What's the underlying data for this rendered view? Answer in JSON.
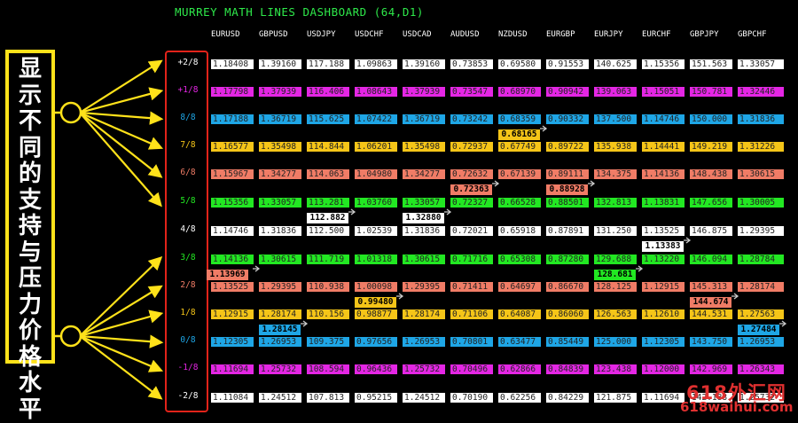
{
  "title": "MURREY MATH LINES DASHBOARD (64,D1)",
  "annotation": "显示不同的支持与压力价格水平",
  "watermark": {
    "line1": "618外汇网",
    "line2": "618waihui.com"
  },
  "colors": {
    "title": "#2ee84a",
    "annotation_box": "#ffe21a",
    "levels_box": "#e2231a"
  },
  "symbols": [
    "EURUSD",
    "GBPUSD",
    "USDJPY",
    "USDCHF",
    "USDCAD",
    "AUDUSD",
    "NZDUSD",
    "EURGBP",
    "EURJPY",
    "EURCHF",
    "GBPJPY",
    "GBPCHF"
  ],
  "levels": [
    {
      "label": "+2/8",
      "color": "#ffffff",
      "values": [
        "1.18408",
        "1.39160",
        "117.188",
        "1.09863",
        "1.39160",
        "0.73853",
        "0.69580",
        "0.91553",
        "140.625",
        "1.15356",
        "151.563",
        "1.33057"
      ]
    },
    {
      "label": "+1/8",
      "color": "#e426e4",
      "values": [
        "1.17798",
        "1.37939",
        "116.406",
        "1.08643",
        "1.37939",
        "0.73547",
        "0.68970",
        "0.90942",
        "139.063",
        "1.15051",
        "150.781",
        "1.32446"
      ]
    },
    {
      "label": "8/8",
      "color": "#1ea6e6",
      "values": [
        "1.17188",
        "1.36719",
        "115.625",
        "1.07422",
        "1.36719",
        "0.73242",
        "0.68359",
        "0.90332",
        "137.500",
        "1.14746",
        "150.000",
        "1.31836"
      ]
    },
    {
      "label": "7/8",
      "color": "#f5c518",
      "values": [
        "1.16577",
        "1.35498",
        "114.844",
        "1.06201",
        "1.35498",
        "0.72937",
        "0.67749",
        "0.89722",
        "135.938",
        "1.14441",
        "149.219",
        "1.31226"
      ]
    },
    {
      "label": "6/8",
      "color": "#f07c66",
      "values": [
        "1.15967",
        "1.34277",
        "114.063",
        "1.04980",
        "1.34277",
        "0.72632",
        "0.67139",
        "0.89111",
        "134.375",
        "1.14136",
        "148.438",
        "1.30615"
      ]
    },
    {
      "label": "5/8",
      "color": "#22e822",
      "values": [
        "1.15356",
        "1.33057",
        "113.281",
        "1.03760",
        "1.33057",
        "0.72327",
        "0.66528",
        "0.88501",
        "132.813",
        "1.13831",
        "147.656",
        "1.30005"
      ]
    },
    {
      "label": "4/8",
      "color": "#ffffff",
      "values": [
        "1.14746",
        "1.31836",
        "112.500",
        "1.02539",
        "1.31836",
        "0.72021",
        "0.65918",
        "0.87891",
        "131.250",
        "1.13525",
        "146.875",
        "1.29395"
      ]
    },
    {
      "label": "3/8",
      "color": "#22e822",
      "values": [
        "1.14136",
        "1.30615",
        "111.719",
        "1.01318",
        "1.30615",
        "0.71716",
        "0.65308",
        "0.87280",
        "129.688",
        "1.13220",
        "146.094",
        "1.28784"
      ]
    },
    {
      "label": "2/8",
      "color": "#f07c66",
      "values": [
        "1.13525",
        "1.29395",
        "110.938",
        "1.00098",
        "1.29395",
        "0.71411",
        "0.64697",
        "0.86670",
        "128.125",
        "1.12915",
        "145.313",
        "1.28174"
      ]
    },
    {
      "label": "1/8",
      "color": "#f5c518",
      "values": [
        "1.12915",
        "1.28174",
        "110.156",
        "0.98877",
        "1.28174",
        "0.71106",
        "0.64087",
        "0.86060",
        "126.563",
        "1.12610",
        "144.531",
        "1.27563"
      ]
    },
    {
      "label": "0/8",
      "color": "#1ea6e6",
      "values": [
        "1.12305",
        "1.26953",
        "109.375",
        "0.97656",
        "1.26953",
        "0.70801",
        "0.63477",
        "0.85449",
        "125.000",
        "1.12305",
        "143.750",
        "1.26953"
      ]
    },
    {
      "label": "-1/8",
      "color": "#e426e4",
      "values": [
        "1.11694",
        "1.25732",
        "108.594",
        "0.96436",
        "1.25732",
        "0.70496",
        "0.62866",
        "0.84839",
        "123.438",
        "1.12000",
        "142.969",
        "1.26343"
      ]
    },
    {
      "label": "-2/8",
      "color": "#ffffff",
      "values": [
        "1.11084",
        "1.24512",
        "107.813",
        "0.95215",
        "1.24512",
        "0.70190",
        "0.62256",
        "0.84229",
        "121.875",
        "1.11694",
        "142.188",
        "1.25732"
      ]
    }
  ],
  "current_prices": [
    {
      "symbol": "EURUSD",
      "price": "1.13969",
      "color": "#f07c66",
      "between": [
        7,
        8
      ]
    },
    {
      "symbol": "GBPUSD",
      "price": "1.28145",
      "color": "#1ea6e6",
      "between": [
        9,
        10
      ]
    },
    {
      "symbol": "USDJPY",
      "price": "112.882",
      "color": "#ffffff",
      "between": [
        5,
        6
      ]
    },
    {
      "symbol": "USDCHF",
      "price": "0.99480",
      "color": "#f5c518",
      "between": [
        8,
        9
      ]
    },
    {
      "symbol": "USDCAD",
      "price": "1.32880",
      "color": "#ffffff",
      "between": [
        5,
        6
      ]
    },
    {
      "symbol": "AUDUSD",
      "price": "0.72363",
      "color": "#f07c66",
      "between": [
        4,
        5
      ]
    },
    {
      "symbol": "NZDUSD",
      "price": "0.68165",
      "color": "#f5c518",
      "between": [
        2,
        3
      ]
    },
    {
      "symbol": "EURGBP",
      "price": "0.88928",
      "color": "#f07c66",
      "between": [
        4,
        5
      ]
    },
    {
      "symbol": "EURJPY",
      "price": "128.681",
      "color": "#22e822",
      "between": [
        7,
        8
      ]
    },
    {
      "symbol": "EURCHF",
      "price": "1.13383",
      "color": "#ffffff",
      "between": [
        6,
        7
      ]
    },
    {
      "symbol": "GBPJPY",
      "price": "144.674",
      "color": "#f07c66",
      "between": [
        8,
        9
      ]
    },
    {
      "symbol": "GBPCHF",
      "price": "1.27484",
      "color": "#1ea6e6",
      "between": [
        9,
        10
      ]
    }
  ]
}
